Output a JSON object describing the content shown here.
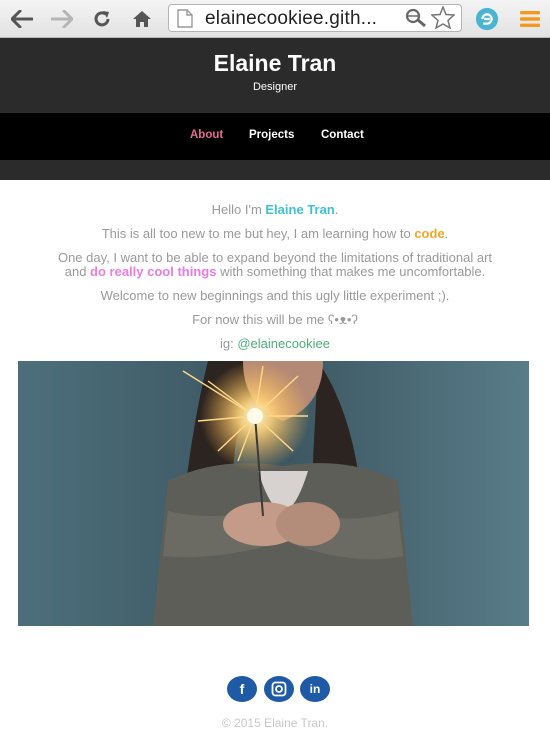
{
  "browser": {
    "url": "elainecookiee.gith...",
    "icons": [
      "back-arrow-icon",
      "forward-arrow-icon",
      "reload-icon",
      "home-icon",
      "page-icon",
      "search-icon",
      "star-icon",
      "evernote-icon",
      "menu-icon"
    ]
  },
  "site": {
    "name": "Elaine Tran",
    "role": "Designer"
  },
  "nav": {
    "items": [
      {
        "label": "About",
        "active": true
      },
      {
        "label": "Projects",
        "active": false
      },
      {
        "label": "Contact",
        "active": false
      }
    ]
  },
  "content": {
    "line1": {
      "pre": "Hello I'm ",
      "name": "Elaine Tran",
      "post": "."
    },
    "line2": {
      "pre": "This is all too new to me but hey, I am learning how to ",
      "word": "code",
      "post": "."
    },
    "line3a": "One day, I want to be able to expand beyond the limitations of traditional art",
    "line3b": {
      "pre": "and ",
      "phrase": "do really cool things",
      "post": " with something that makes me uncomfortable."
    },
    "line4": "Welcome to new beginnings and this ugly little experiment ;).",
    "line5": "For now this will be me ʕ•ᴥ•ʔ",
    "line6": {
      "pre": "ig: ",
      "handle": "@elainecookiee"
    }
  },
  "colors": {
    "teal": "#3cc3cf",
    "orange": "#f5a623",
    "pink": "#e87ce0",
    "green": "#4cae7a",
    "nav_active": "#e56b94",
    "header_bg": "#2b2b2b"
  },
  "footer": {
    "social": [
      {
        "icon": "facebook-icon",
        "glyph": "f"
      },
      {
        "icon": "instagram-icon",
        "glyph": ""
      },
      {
        "icon": "linkedin-icon",
        "glyph": "in"
      }
    ],
    "copyright": "© 2015 Elaine Tran."
  }
}
